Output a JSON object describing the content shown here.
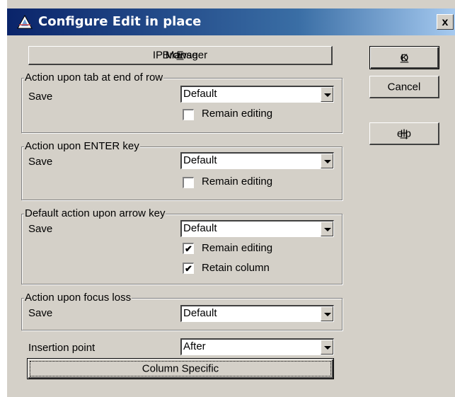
{
  "window": {
    "title": "Configure Edit in place",
    "close_label": "x"
  },
  "buttons": {
    "browse_prefix": "Browse ",
    "browse_mnemonic": "E",
    "browse_suffix": "IP Manager",
    "ok_mnemonic": "O",
    "ok_suffix": "K",
    "cancel": "Cancel",
    "help_mnemonic": "H",
    "help_suffix": "elp",
    "column_specific": "Column Specific"
  },
  "groups": [
    {
      "title": "Action upon tab at end of row",
      "save_label": "Save",
      "select_value": "Default",
      "remain_editing_label": "Remain editing",
      "remain_editing_checked": false
    },
    {
      "title": "Action upon ENTER key",
      "save_label": "Save",
      "select_value": "Default",
      "remain_editing_label": "Remain editing",
      "remain_editing_checked": false
    },
    {
      "title": "Default action upon arrow key",
      "save_label": "Save",
      "select_value": "Default",
      "remain_editing_label": "Remain editing",
      "remain_editing_checked": true,
      "retain_column_label": "Retain column",
      "retain_column_checked": true
    },
    {
      "title": "Action upon focus loss",
      "save_label": "Save",
      "select_value": "Default"
    }
  ],
  "insertion": {
    "label": "Insertion point",
    "value": "After"
  },
  "checkmark": "✔"
}
